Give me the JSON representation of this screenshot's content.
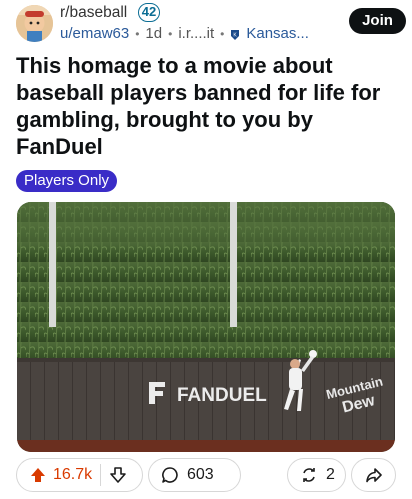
{
  "post": {
    "subreddit": "r/baseball",
    "subreddit_badge": "42",
    "username": "u/emaw63",
    "age": "1d",
    "domain": "i.r....it",
    "user_flair": "Kansas...",
    "join_label": "Join",
    "title": "This homage to a movie about baseball players banned for life for gambling, brought to you by FanDuel",
    "post_flair": "Players Only"
  },
  "media": {
    "wall_sign_left": "FANDUEL",
    "wall_sign_right_top": "Mountain",
    "wall_sign_right_bottom": "Dew"
  },
  "actions": {
    "upvotes": "16.7k",
    "comments": "603",
    "crossposts": "2"
  },
  "colors": {
    "upvote_accent": "#d93a00",
    "flair_background": "#3a2cc7",
    "join_background": "#0e1113",
    "link_blue": "#2b5a9a"
  },
  "icons": [
    "upvote-icon",
    "downvote-icon",
    "comment-icon",
    "crosspost-icon",
    "share-icon",
    "kansas-city-flair-icon"
  ]
}
